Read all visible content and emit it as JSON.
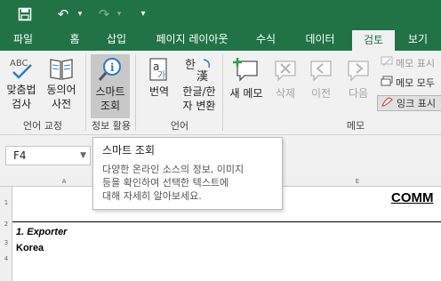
{
  "quick_access": {
    "undo_icon": "undo-icon",
    "redo_icon": "redo-icon"
  },
  "tabs": [
    {
      "label": "파일"
    },
    {
      "label": "홈"
    },
    {
      "label": "삽입"
    },
    {
      "label": "페이지 레이아웃"
    },
    {
      "label": "수식"
    },
    {
      "label": "데이터"
    },
    {
      "label": "검토"
    },
    {
      "label": "보기"
    }
  ],
  "active_tab": "검토",
  "ribbon": {
    "spelling": {
      "line1": "맞춤법",
      "line2": "검사"
    },
    "thesaurus": {
      "line1": "동의어",
      "line2": "사전"
    },
    "smart_lookup": {
      "line1": "스마트",
      "line2": "조회"
    },
    "translate": {
      "label": "번역"
    },
    "hangul_hanja": {
      "line1": "한글/한",
      "line2": "자 변환"
    },
    "new_comment": {
      "label": "새 메모"
    },
    "delete_comment": {
      "label": "삭제"
    },
    "previous_comment": {
      "label": "이전"
    },
    "next_comment": {
      "label": "다음"
    },
    "show_comment": {
      "label": "메모 표시"
    },
    "show_all_comments": {
      "label": "메모 모두"
    },
    "show_ink": {
      "label": "잉크 표시"
    },
    "groups": {
      "proofing": "언어 교정",
      "insights": "정보 활용",
      "language": "언어",
      "comments": "메모"
    }
  },
  "name_box": {
    "value": "F4"
  },
  "columns": [
    "A",
    "B",
    "C",
    "D",
    "E"
  ],
  "rows": [
    "1",
    "2",
    "3",
    "4"
  ],
  "cells": {
    "a3": "1. Exporter",
    "a4": "Korea",
    "e1": "COMM"
  },
  "tooltip": {
    "title": "스마트 조회",
    "line1": "다양한 온라인 소스의 정보, 이미지",
    "line2": "등을 확인하여 선택한 텍스트에",
    "line3": "대해 자세히 알아보세요."
  },
  "colors": {
    "brand": "#217346",
    "ribbon": "#f1f1f1",
    "highlight": "#c8c8c8"
  }
}
